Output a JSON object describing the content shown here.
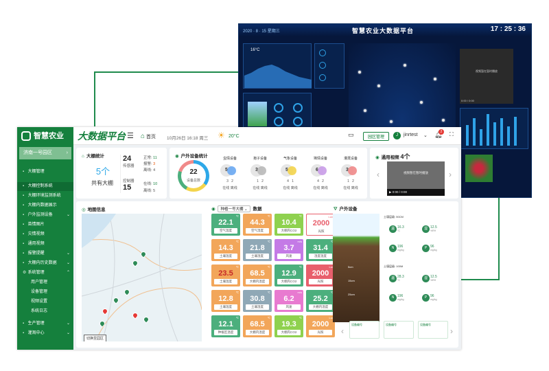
{
  "bigscreen": {
    "title": "智慧农业大数据平台",
    "date": "2020 · 8 · 15 星期三",
    "time": "17 : 25 : 36",
    "weather_temp": "16°C",
    "video_msg": "视频暂在暂时播放",
    "video_time": "0:00 / 0:00"
  },
  "topbar": {
    "brand": "智慧农业",
    "platform": "大数据平台",
    "home": "首页",
    "datetime": "10月26日 16:18 周三",
    "temperature": "20°C",
    "manage_btn": "园区管理",
    "user": "jinrtest",
    "avatar_letter": "J",
    "notif_count": "2"
  },
  "sidebar": {
    "park": "济南一号园区",
    "items": [
      {
        "label": "大棚管理",
        "sub": false
      },
      {
        "label": "大棚控制系统",
        "sub": false
      },
      {
        "label": "大棚环境监测系统",
        "sub": false
      },
      {
        "label": "大棚内数据展示",
        "sub": false
      },
      {
        "label": "户外监测设备",
        "sub": false
      },
      {
        "label": "苗情图片",
        "sub": false
      },
      {
        "label": "灾情视频",
        "sub": false
      },
      {
        "label": "通用视频",
        "sub": false
      },
      {
        "label": "报警提醒",
        "sub": false
      },
      {
        "label": "大棚内历史数据",
        "sub": false
      },
      {
        "label": "系统管理",
        "sub": false
      },
      {
        "label": "用户管理",
        "sub": true
      },
      {
        "label": "设备管理",
        "sub": true
      },
      {
        "label": "视频设置",
        "sub": true
      },
      {
        "label": "系统日志",
        "sub": true
      },
      {
        "label": "生产管理",
        "sub": false
      },
      {
        "label": "灌溉中心",
        "sub": false
      }
    ]
  },
  "greenhouse": {
    "title": "大棚统计",
    "count": "5个",
    "count_label": "共有大棚",
    "sensors": "24",
    "sensors_label": "传感器",
    "normal_label": "正常:",
    "normal": "11",
    "alarm_label": "报警:",
    "alarm": "3",
    "offline_label": "离线:",
    "offline": "4",
    "controllers": "15",
    "controllers_label": "控制器",
    "online_label": "在线:",
    "online2": "10",
    "offline2_label": "离线:",
    "offline2": "5"
  },
  "outdoor_stats": {
    "title": "户外设备统计",
    "total": "22",
    "total_label": "设备总数",
    "online_label": "在线",
    "offline_label": "离线",
    "devices": [
      {
        "name": "虫情设备",
        "count": "5",
        "online": "3",
        "offline": "2",
        "color": "#6aa8f2"
      },
      {
        "name": "孢子设备",
        "count": "3",
        "online": "1",
        "offline": "2",
        "color": "#b9b9b9"
      },
      {
        "name": "气象设备",
        "count": "5",
        "online": "4",
        "offline": "1",
        "color": "#f3d44c"
      },
      {
        "name": "墒情设备",
        "count": "6",
        "online": "4",
        "offline": "2",
        "color": "#c99ce8"
      },
      {
        "name": "灌溉设备",
        "count": "3",
        "online": "1",
        "offline": "2",
        "color": "#f08a8a"
      }
    ]
  },
  "video": {
    "title": "通用视频",
    "count": "4个",
    "message": "视频暂在暂时播放",
    "time": "0:00 / 0:00"
  },
  "map": {
    "title": "地图信息",
    "button": "切换至园区"
  },
  "data_panel": {
    "selector": "种植一号大棚",
    "suffix": "数据",
    "tiles": [
      {
        "val": "22.1",
        "unit": "℃",
        "label": "空气温度",
        "color": "#4caf7d"
      },
      {
        "val": "44.3",
        "unit": "℃",
        "label": "空气湿度",
        "color": "#f2a65a"
      },
      {
        "val": "10.4",
        "unit": "℃",
        "label": "大棚内CO2",
        "color": "#8fd14f"
      },
      {
        "val": "2000",
        "unit": "Lux",
        "label": "光照",
        "color": "#e85f6c"
      },
      {
        "val": "14.3",
        "unit": "℃",
        "label": "土壤温度",
        "color": "#f2a65a"
      },
      {
        "val": "21.8",
        "unit": "℃",
        "label": "土壤湿度",
        "color": "#8fa8b6"
      },
      {
        "val": "3.7",
        "unit": "m/s",
        "label": "风速",
        "color": "#c47ae6"
      },
      {
        "val": "31.4",
        "unit": "℃",
        "label": "湿度温度",
        "color": "#4caf7d"
      },
      {
        "val": "23.5",
        "unit": "℃",
        "label": "土壤温度",
        "color": "#f2a65a"
      },
      {
        "val": "68.5",
        "unit": "℃",
        "label": "大棚内温度",
        "color": "#f2a65a"
      },
      {
        "val": "12.9",
        "unit": "℃",
        "label": "大棚内CO2",
        "color": "#4caf7d"
      },
      {
        "val": "2000",
        "unit": "Lux",
        "label": "光照",
        "color": "#e85f6c"
      },
      {
        "val": "12.8",
        "unit": "℃",
        "label": "土壤温度",
        "color": "#f2a65a"
      },
      {
        "val": "30.8",
        "unit": "℃",
        "label": "土壤湿度",
        "color": "#8fa8b6"
      },
      {
        "val": "6.2",
        "unit": "m/s",
        "label": "风速",
        "color": "#e87ad0"
      },
      {
        "val": "25.2",
        "unit": "℃",
        "label": "大棚内温度",
        "color": "#4caf7d"
      },
      {
        "val": "12.1",
        "unit": "℃",
        "label": "种植区温度",
        "color": "#4caf7d"
      },
      {
        "val": "68.5",
        "unit": "℃",
        "label": "大棚内温度",
        "color": "#f2a65a"
      },
      {
        "val": "19.3",
        "unit": "℃",
        "label": "大棚内CO2",
        "color": "#8fd14f"
      },
      {
        "val": "2000",
        "unit": "Lux",
        "label": "光照",
        "color": "#f2a65a"
      }
    ]
  },
  "outdoor": {
    "title": "户外设备",
    "soil_label_1": "土壤层级: 50CM",
    "soil_label_2": "土壤层级: 100M",
    "depths": [
      "5cm",
      "15cm",
      "25cm"
    ],
    "sensors": [
      {
        "ico": "温",
        "val": "16.3",
        "unit": "°C"
      },
      {
        "ico": "湿",
        "val": "12.5",
        "unit": "%RH"
      },
      {
        "ico": "N",
        "val": "196",
        "unit": "mg/kg"
      },
      {
        "ico": "P",
        "val": "96",
        "unit": "mg/kg"
      },
      {
        "ico": "温",
        "val": "28.3",
        "unit": "°C"
      },
      {
        "ico": "湿",
        "val": "12.5",
        "unit": "%RH"
      },
      {
        "ico": "N",
        "val": "196",
        "unit": "mg/kg"
      },
      {
        "ico": "P",
        "val": "96",
        "unit": "mg/kg"
      }
    ],
    "mini_label": "设备编号"
  }
}
